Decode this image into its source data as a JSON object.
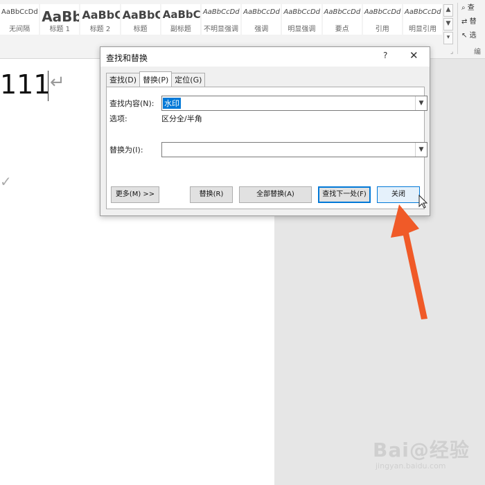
{
  "ribbon": {
    "styles": [
      {
        "sample": "AaBbCcDd",
        "name": "无间隔",
        "size": 10
      },
      {
        "sample": "AaBb",
        "name": "标题 1",
        "size": 20
      },
      {
        "sample": "AaBbC",
        "name": "标题 2",
        "size": 16
      },
      {
        "sample": "AaBbC",
        "name": "标题",
        "size": 16
      },
      {
        "sample": "AaBbC",
        "name": "副标题",
        "size": 15
      },
      {
        "sample": "AaBbCcDd",
        "name": "不明显强调",
        "size": 10
      },
      {
        "sample": "AaBbCcDd",
        "name": "强调",
        "size": 10
      },
      {
        "sample": "AaBbCcDd",
        "name": "明显强调",
        "size": 10
      },
      {
        "sample": "AaBbCcDd",
        "name": "要点",
        "size": 10
      },
      {
        "sample": "AaBbCcDd",
        "name": "引用",
        "size": 10
      },
      {
        "sample": "AaBbCcDd",
        "name": "明显引用",
        "size": 10
      }
    ],
    "editing": {
      "find": "查",
      "replace": "替",
      "select": "选",
      "group_label": "编"
    }
  },
  "document": {
    "text": "111",
    "para_mark": "↵",
    "margin_mark": "✓"
  },
  "dialog": {
    "title": "查找和替换",
    "help": "?",
    "close": "✕",
    "tabs": [
      {
        "label": "查找(D)",
        "active": false
      },
      {
        "label": "替换(P)",
        "active": true
      },
      {
        "label": "定位(G)",
        "active": false
      }
    ],
    "find_label": "查找内容(N):",
    "find_value": "水印",
    "options_label": "选项:",
    "options_value": "区分全/半角",
    "replace_label": "替换为(I):",
    "replace_value": "",
    "buttons": {
      "more": "更多(M) >>",
      "replace": "替换(R)",
      "replace_all": "全部替换(A)",
      "find_next": "查找下一处(F)",
      "close": "关闭"
    }
  },
  "colors": {
    "accent": "#0078d7",
    "annotation_arrow": "#f05a28"
  },
  "watermark": {
    "main": "Bai@经验",
    "sub": "jingyan.baidu.com"
  }
}
